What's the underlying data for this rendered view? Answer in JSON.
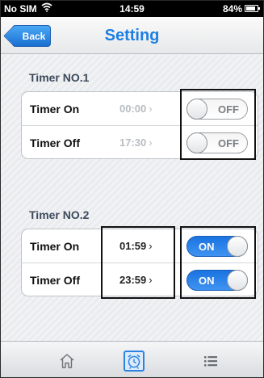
{
  "status_bar": {
    "carrier": "No SIM",
    "time": "14:59",
    "battery": "84%"
  },
  "nav": {
    "back_label": "Back",
    "title": "Setting"
  },
  "timers": [
    {
      "title": "Timer NO.1",
      "rows": [
        {
          "label": "Timer On",
          "time": "00:00",
          "toggle": "OFF"
        },
        {
          "label": "Timer Off",
          "time": "17:30",
          "toggle": "OFF"
        }
      ]
    },
    {
      "title": "Timer NO.2",
      "rows": [
        {
          "label": "Timer On",
          "time": "01:59",
          "toggle": "ON"
        },
        {
          "label": "Timer Off",
          "time": "23:59",
          "toggle": "ON"
        }
      ]
    }
  ],
  "tab_bar": {
    "items": [
      "home-icon",
      "alarm-clock-icon",
      "list-icon"
    ],
    "selected": "alarm-clock-icon"
  },
  "colors": {
    "accent": "#1f7fe0",
    "toggle_on": "#2a82e2"
  }
}
